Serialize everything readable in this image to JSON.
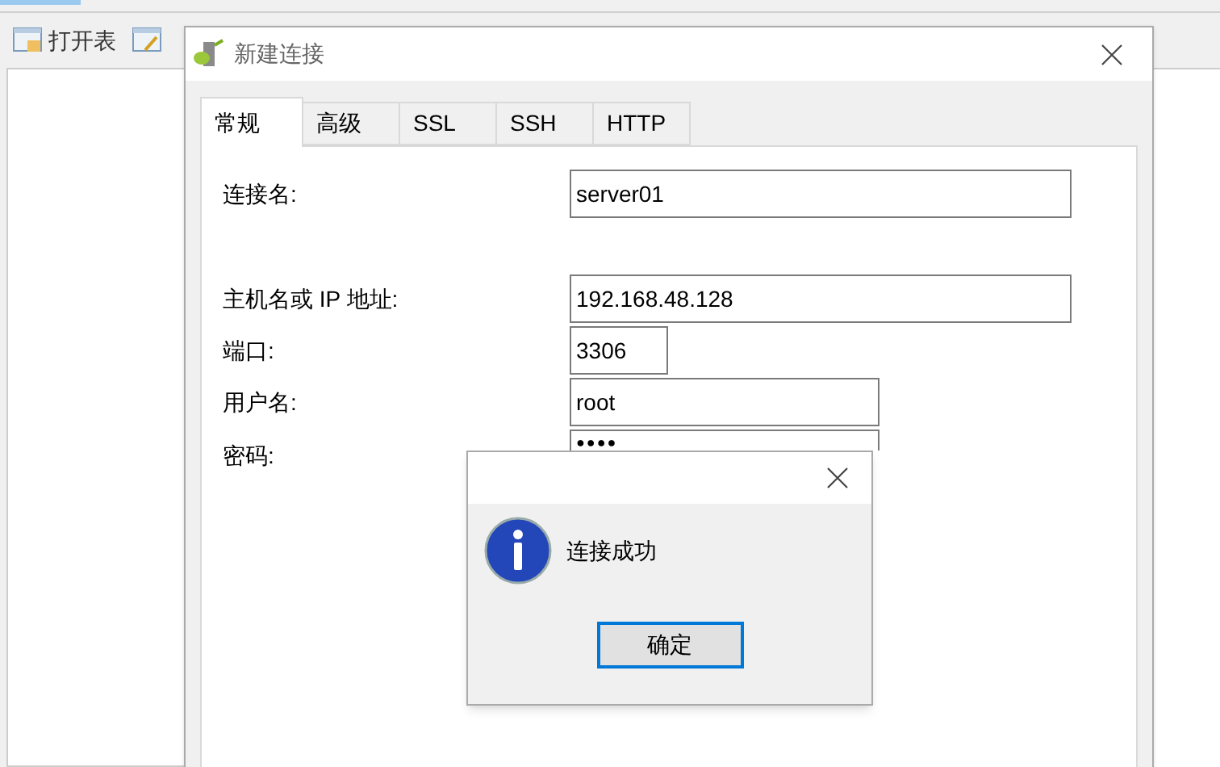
{
  "toolbar": {
    "buttons": [
      {
        "label": "打开表"
      }
    ]
  },
  "dialog": {
    "title": "新建连接",
    "tabs": [
      {
        "label": "常规",
        "selected": true
      },
      {
        "label": "高级",
        "selected": false
      },
      {
        "label": "SSL",
        "selected": false
      },
      {
        "label": "SSH",
        "selected": false
      },
      {
        "label": "HTTP",
        "selected": false
      }
    ],
    "fields": [
      {
        "label": "连接名:",
        "value": "server01"
      },
      {
        "label": "主机名或 IP 地址:",
        "value": "192.168.48.128"
      },
      {
        "label": "端口:",
        "value": "3306"
      },
      {
        "label": "用户名:",
        "value": "root"
      },
      {
        "label": "密码:",
        "value": "●●●●"
      }
    ]
  },
  "message_box": {
    "message": "连接成功",
    "buttons": [
      {
        "label": "确定"
      }
    ]
  }
}
